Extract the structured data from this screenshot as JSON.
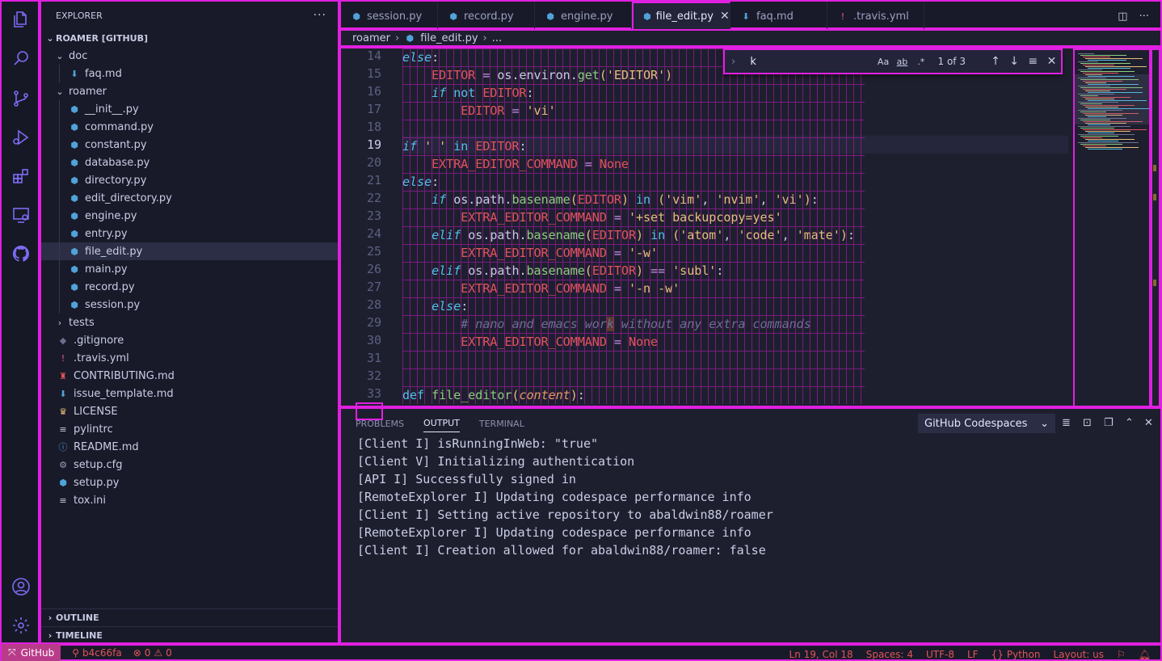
{
  "activity_bar": {
    "items": [
      {
        "icon": "files-icon"
      },
      {
        "icon": "search-icon"
      },
      {
        "icon": "source-control-icon"
      },
      {
        "icon": "run-debug-icon"
      },
      {
        "icon": "extensions-icon"
      },
      {
        "icon": "remote-explorer-icon"
      },
      {
        "icon": "github-icon"
      }
    ],
    "bottom": [
      {
        "icon": "account-icon"
      },
      {
        "icon": "settings-gear-icon"
      }
    ]
  },
  "sidebar": {
    "title": "EXPLORER",
    "more": "···",
    "project": "ROAMER [GITHUB]",
    "tree": [
      {
        "label": "doc",
        "type": "folder",
        "depth": 1,
        "open": true
      },
      {
        "label": "faq.md",
        "type": "md",
        "depth": 2
      },
      {
        "label": "roamer",
        "type": "folder",
        "depth": 1,
        "open": true
      },
      {
        "label": "__init__.py",
        "type": "py",
        "depth": 2
      },
      {
        "label": "command.py",
        "type": "py",
        "depth": 2
      },
      {
        "label": "constant.py",
        "type": "py",
        "depth": 2
      },
      {
        "label": "database.py",
        "type": "py",
        "depth": 2
      },
      {
        "label": "directory.py",
        "type": "py",
        "depth": 2
      },
      {
        "label": "edit_directory.py",
        "type": "py",
        "depth": 2
      },
      {
        "label": "engine.py",
        "type": "py",
        "depth": 2
      },
      {
        "label": "entry.py",
        "type": "py",
        "depth": 2
      },
      {
        "label": "file_edit.py",
        "type": "py",
        "depth": 2,
        "selected": true
      },
      {
        "label": "main.py",
        "type": "py",
        "depth": 2
      },
      {
        "label": "record.py",
        "type": "py",
        "depth": 2
      },
      {
        "label": "session.py",
        "type": "py",
        "depth": 2
      },
      {
        "label": "tests",
        "type": "folder",
        "depth": 1,
        "open": false
      },
      {
        "label": ".gitignore",
        "type": "git",
        "depth": 1
      },
      {
        "label": ".travis.yml",
        "type": "yml",
        "depth": 1
      },
      {
        "label": "CONTRIBUTING.md",
        "type": "contrib",
        "depth": 1
      },
      {
        "label": "issue_template.md",
        "type": "md",
        "depth": 1
      },
      {
        "label": "LICENSE",
        "type": "license",
        "depth": 1
      },
      {
        "label": "pylintrc",
        "type": "text",
        "depth": 1
      },
      {
        "label": "README.md",
        "type": "info",
        "depth": 1
      },
      {
        "label": "setup.cfg",
        "type": "gear",
        "depth": 1
      },
      {
        "label": "setup.py",
        "type": "py",
        "depth": 1
      },
      {
        "label": "tox.ini",
        "type": "text",
        "depth": 1
      }
    ],
    "outline": "OUTLINE",
    "timeline": "TIMELINE"
  },
  "tabs": [
    {
      "label": "session.py",
      "type": "py"
    },
    {
      "label": "record.py",
      "type": "py"
    },
    {
      "label": "engine.py",
      "type": "py"
    },
    {
      "label": "file_edit.py",
      "type": "py",
      "active": true,
      "close": "✕"
    },
    {
      "label": "faq.md",
      "type": "md"
    },
    {
      "label": ".travis.yml",
      "type": "yml"
    }
  ],
  "breadcrumb": {
    "folder": "roamer",
    "file": "file_edit.py",
    "more": "..."
  },
  "find": {
    "value": "k",
    "match_case": "Aa",
    "whole_word": "ab",
    "regex": ".*",
    "count": "1 of 3"
  },
  "editor": {
    "current_line": 19,
    "lines": [
      {
        "n": 14,
        "html": "<span class='kwi'>else</span>:"
      },
      {
        "n": 15,
        "html": "    <span class='var'>EDITOR</span> <span class='op'>=</span> os.environ.<span class='fn'>get</span><span class='br'>(</span><span class='str'>'EDITOR'</span><span class='br'>)</span>"
      },
      {
        "n": 16,
        "html": "    <span class='kwi'>if</span> <span class='kw'>not</span> <span class='var'>EDITOR</span>:"
      },
      {
        "n": 17,
        "html": "        <span class='var'>EDITOR</span> <span class='op'>=</span> <span class='str'>'vi'</span>"
      },
      {
        "n": 18,
        "html": ""
      },
      {
        "n": 19,
        "html": "<span class='kwi'>if</span> <span class='str'>' '</span> <span class='kw'>in</span> <span class='var'>EDITOR</span>:"
      },
      {
        "n": 20,
        "html": "    <span class='var'>EXTRA_EDITOR_COMMAND</span> <span class='op'>=</span> <span class='var'>None</span>"
      },
      {
        "n": 21,
        "html": "<span class='kwi'>else</span>:"
      },
      {
        "n": 22,
        "html": "    <span class='kwi'>if</span> os.path.<span class='fn'>basename</span><span class='br'>(</span><span class='var'>EDITOR</span><span class='br'>)</span> <span class='kw'>in</span> <span class='br'>(</span><span class='str'>'vim'</span>, <span class='str'>'nvim'</span>, <span class='str'>'vi'</span><span class='br'>)</span>:"
      },
      {
        "n": 23,
        "html": "        <span class='var'>EXTRA_EDITOR_COMMAND</span> <span class='op'>=</span> <span class='str'>'+set backupcopy=yes'</span>"
      },
      {
        "n": 24,
        "html": "    <span class='kwi'>elif</span> os.path.<span class='fn'>basename</span><span class='br'>(</span><span class='var'>EDITOR</span><span class='br'>)</span> <span class='kw'>in</span> <span class='br'>(</span><span class='str'>'atom'</span>, <span class='str'>'code'</span>, <span class='str'>'mate'</span><span class='br'>)</span>:"
      },
      {
        "n": 25,
        "html": "        <span class='var'>EXTRA_EDITOR_COMMAND</span> <span class='op'>=</span> <span class='str'>'-w'</span>"
      },
      {
        "n": 26,
        "html": "    <span class='kwi'>elif</span> os.path.<span class='fn'>basename</span><span class='br'>(</span><span class='var'>EDITOR</span><span class='br'>)</span> <span class='op'>==</span> <span class='str'>'subl'</span>:"
      },
      {
        "n": 27,
        "html": "        <span class='var'>EXTRA_EDITOR_COMMAND</span> <span class='op'>=</span> <span class='str'>'-n -w'</span>"
      },
      {
        "n": 28,
        "html": "    <span class='kwi'>else</span>:"
      },
      {
        "n": 29,
        "html": "        <span class='cm'># nano and emacs wor<span class='hl'>k</span> without any extra commands</span>"
      },
      {
        "n": 30,
        "html": "        <span class='var'>EXTRA_EDITOR_COMMAND</span> <span class='op'>=</span> <span class='var'>None</span>"
      },
      {
        "n": 31,
        "html": ""
      },
      {
        "n": 32,
        "html": ""
      },
      {
        "n": 33,
        "html": "<span class='kw'>def</span> <span class='fn'>file_editor</span><span class='br'>(</span><span class='pl'>content</span><span class='br'>)</span>:"
      }
    ]
  },
  "panel": {
    "tabs": [
      {
        "label": "PROBLEMS"
      },
      {
        "label": "OUTPUT",
        "active": true
      },
      {
        "label": "TERMINAL"
      }
    ],
    "channel": "GitHub Codespaces",
    "output": [
      "[Client I] isRunningInWeb: \"true\"",
      "[Client V] Initializing authentication",
      "[API I] Successfully signed in",
      "[RemoteExplorer I] Updating codespace performance info",
      "[Client I] Setting active repository to abaldwin88/roamer",
      "[RemoteExplorer I] Updating codespace performance info",
      "[Client I] Creation allowed for abaldwin88/roamer: false"
    ]
  },
  "status": {
    "remote": "GitHub",
    "branch": "b4c66fa",
    "errors": "0",
    "warnings": "0",
    "position": "Ln 19, Col 18",
    "spaces": "Spaces: 4",
    "encoding": "UTF-8",
    "eol": "LF",
    "language": "Python",
    "layout": "Layout: us"
  },
  "colors": {
    "accent": "#e020e0",
    "remote_bg": "#b83c8a",
    "status_text": "#e0555a"
  }
}
